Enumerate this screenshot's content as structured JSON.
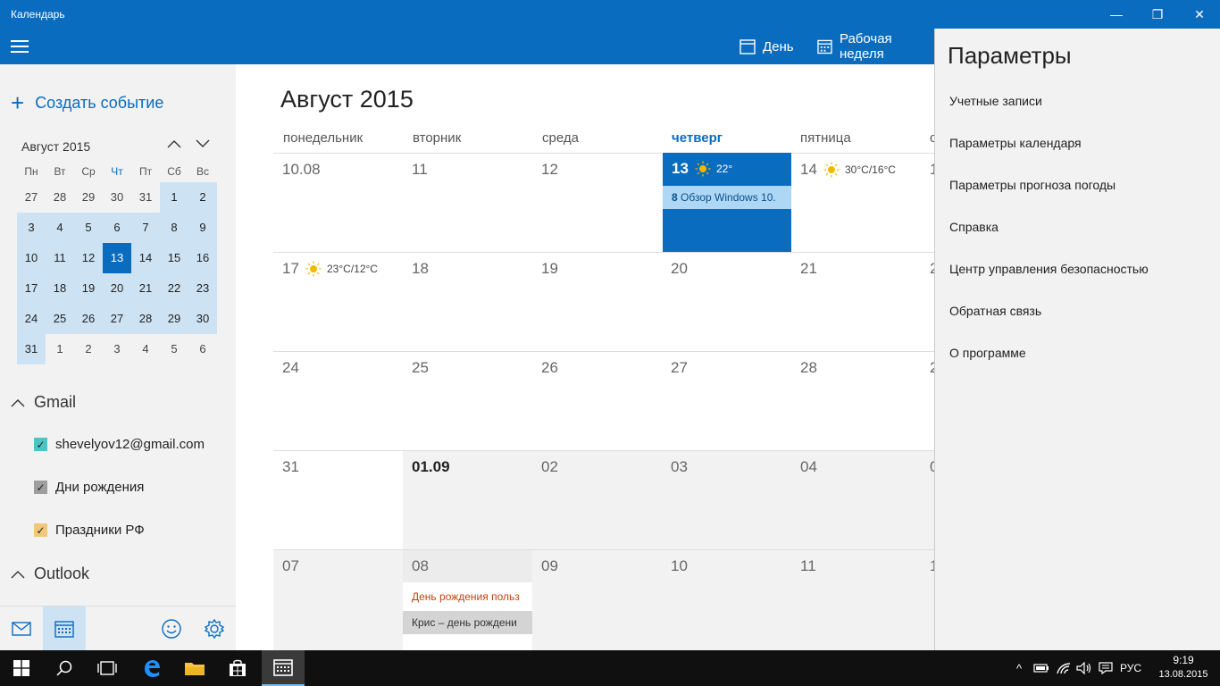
{
  "window": {
    "title": "Календарь",
    "minimize_glyph": "—",
    "restore_glyph": "❐",
    "close_glyph": "✕"
  },
  "toolbar": {
    "day_label": "День",
    "work_week_label": "Рабочая неделя"
  },
  "sidebar": {
    "create_event_glyph": "+",
    "create_event": "Создать событие",
    "mini_calendar": {
      "month_label": "Август 2015",
      "weekdays": [
        "Пн",
        "Вт",
        "Ср",
        "Чт",
        "Пт",
        "Сб",
        "Вс"
      ],
      "weeks": [
        [
          "27",
          "28",
          "29",
          "30",
          "31",
          "1",
          "2"
        ],
        [
          "3",
          "4",
          "5",
          "6",
          "7",
          "8",
          "9"
        ],
        [
          "10",
          "11",
          "12",
          "13",
          "14",
          "15",
          "16"
        ],
        [
          "17",
          "18",
          "19",
          "20",
          "21",
          "22",
          "23"
        ],
        [
          "24",
          "25",
          "26",
          "27",
          "28",
          "29",
          "30"
        ],
        [
          "31",
          "1",
          "2",
          "3",
          "4",
          "5",
          "6"
        ]
      ],
      "selected_day": "13"
    },
    "accounts": [
      {
        "name": "Gmail",
        "calendars": [
          {
            "name": "shevelyov12@gmail.com",
            "color": "#4dc4c4",
            "checked": true,
            "check_glyph": "✓"
          },
          {
            "name": "Дни рождения",
            "color": "#9e9e9e",
            "checked": true,
            "check_glyph": "✓"
          },
          {
            "name": "Праздники РФ",
            "color": "#f2c77a",
            "checked": true,
            "check_glyph": "✓"
          }
        ]
      },
      {
        "name": "Outlook",
        "calendars": []
      }
    ]
  },
  "main": {
    "month_title": "Август 2015",
    "weekday_headers": [
      "понедельник",
      "вторник",
      "среда",
      "четверг",
      "пятница",
      "с"
    ],
    "today_column": 3,
    "weeks": [
      [
        {
          "num": "10.08"
        },
        {
          "num": "11"
        },
        {
          "num": "12"
        },
        {
          "num": "13",
          "today": true,
          "weather": "22°"
        },
        {
          "num": "14",
          "weather": "30°C/16°C"
        },
        {
          "num": "1"
        }
      ],
      [
        {
          "num": "17",
          "weather": "23°C/12°C"
        },
        {
          "num": "18"
        },
        {
          "num": "19"
        },
        {
          "num": "20"
        },
        {
          "num": "21"
        },
        {
          "num": "2"
        }
      ],
      [
        {
          "num": "24"
        },
        {
          "num": "25"
        },
        {
          "num": "26"
        },
        {
          "num": "27"
        },
        {
          "num": "28"
        },
        {
          "num": "2"
        }
      ],
      [
        {
          "num": "31"
        },
        {
          "num": "01.09",
          "bold": true,
          "grey": true
        },
        {
          "num": "02",
          "grey": true
        },
        {
          "num": "03",
          "grey": true
        },
        {
          "num": "04",
          "grey": true
        },
        {
          "num": "0",
          "grey": true
        }
      ],
      [
        {
          "num": "07",
          "grey": true
        },
        {
          "num": "08"
        },
        {
          "num": "09",
          "grey": true
        },
        {
          "num": "10",
          "grey": true
        },
        {
          "num": "11",
          "grey": true
        },
        {
          "num": "1",
          "grey": true
        }
      ]
    ],
    "events": {
      "today_event_hour": "8",
      "today_event_title": "Обзор Windows 10.",
      "birthday_event": "День рождения польз",
      "chris_event": "Крис – день рождени"
    }
  },
  "settings": {
    "title": "Параметры",
    "items": [
      "Учетные записи",
      "Параметры календаря",
      "Параметры прогноза погоды",
      "Справка",
      "Центр управления безопасностью",
      "Обратная связь",
      "О программе"
    ]
  },
  "taskbar": {
    "language": "РУС",
    "time": "9:19",
    "date": "13.08.2015",
    "chevron_glyph": "^"
  },
  "colors": {
    "accent": "#0a6cbf",
    "today_event_bg": "#aed6f5",
    "selection_light": "#cde3f3",
    "birthday_event_text": "#c1440e",
    "chris_event_bg": "#d4d4d4"
  }
}
